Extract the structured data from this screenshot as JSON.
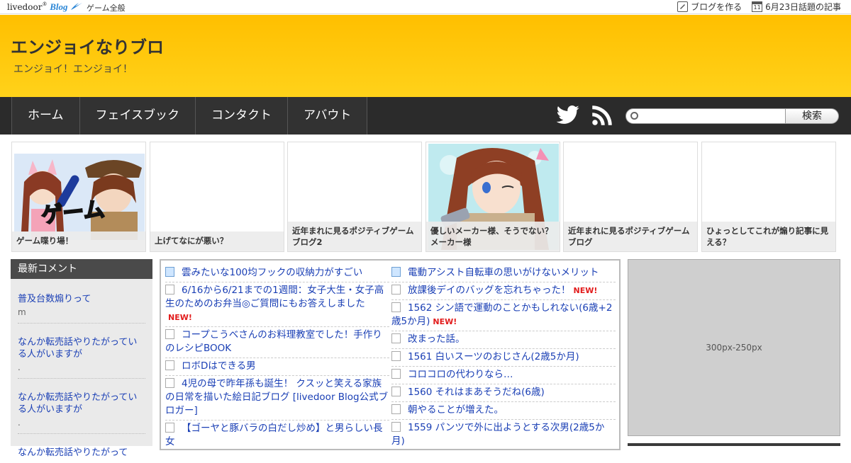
{
  "topbar": {
    "logo_text": "livedoor",
    "logo_blog": "Blog",
    "category": "ゲーム全般",
    "create_blog": "ブログを作る",
    "calendar_day": "11",
    "topic_articles": "6月23日話題の記事"
  },
  "header": {
    "title": "エンジョイなりブロ",
    "subtitle": "エンジョイ！エンジョイ！"
  },
  "nav": {
    "items": [
      "ホーム",
      "フェイスブック",
      "コンタクト",
      "アバウト"
    ],
    "search_button": "検索",
    "search_placeholder": ""
  },
  "thumbnails": [
    {
      "caption": "ゲーム喋り場！",
      "image": "game-chat-characters",
      "art_text": "ゲーム"
    },
    {
      "caption": "上げてなにが悪い？",
      "image": ""
    },
    {
      "caption": "近年まれに見るポジティブゲームブログ2",
      "image": ""
    },
    {
      "caption": "優しいメーカー様、そうでない？メーカー様",
      "image": "winking-girl-character"
    },
    {
      "caption": "近年まれに見るポジティブゲームブログ",
      "image": ""
    },
    {
      "caption": "ひょっとしてこれが煽り記事に見える？",
      "image": ""
    }
  ],
  "sidebar": {
    "heading": "最新コメント",
    "comments": [
      {
        "title": "普及台数煽りって",
        "author": "m"
      },
      {
        "title": "なんか転売話やりたがっている人がいますが",
        "author": "."
      },
      {
        "title": "なんか転売話やりたがっている人がいますが",
        "author": "."
      },
      {
        "title": "なんか転売話やりたがって",
        "author": ""
      }
    ]
  },
  "feed": {
    "new_label": "NEW!",
    "left": [
      {
        "title": "雲みたいな100均フックの収納力がすごい",
        "icon": "pen",
        "new": false
      },
      {
        "title": "6/16から6/21までの1週間：女子大生・女子高生のためのお弁当◎ご質問にもお答えしました",
        "icon": "doc",
        "new": true
      },
      {
        "title": "コープこうべさんのお料理教室でした！手作りのレシピBOOK",
        "icon": "doc",
        "new": false
      },
      {
        "title": "ロボDはできる男",
        "icon": "doc",
        "new": false
      },
      {
        "title": "4児の母で昨年孫も誕生！ クスッと笑える家族の日常を描いた絵日記ブログ [livedoor Blog公式ブロガー]",
        "icon": "doc",
        "new": false
      },
      {
        "title": "【ゴーヤと豚バラの白だし炒め】と男らしい長女",
        "icon": "doc",
        "new": false
      }
    ],
    "right": [
      {
        "title": "電動アシスト自転車の思いがけないメリット",
        "icon": "pen",
        "new": false
      },
      {
        "title": "放課後デイのバッグを忘れちゃった！",
        "icon": "doc",
        "new": true
      },
      {
        "title": "1562 シン語で運動のことかもしれない(6歳+2歳5か月)",
        "icon": "doc",
        "new": true
      },
      {
        "title": "改まった話。",
        "icon": "doc",
        "new": false
      },
      {
        "title": "1561 白いスーツのおじさん(2歳5か月)",
        "icon": "doc",
        "new": false
      },
      {
        "title": "コロコロの代わりなら…",
        "icon": "doc",
        "new": false
      },
      {
        "title": "1560 それはまあそうだね(6歳)",
        "icon": "doc",
        "new": false
      },
      {
        "title": "朝やることが増えた。",
        "icon": "doc",
        "new": false
      },
      {
        "title": "1559 パンツで外に出ようとする次男(2歳5か月)",
        "icon": "doc",
        "new": false
      }
    ]
  },
  "ad": {
    "label": "300px-250px"
  },
  "colors": {
    "header_bg": "#ffc400",
    "nav_bg": "#2b2b2b",
    "link": "#1a3fb5",
    "new_badge": "#e21c1c"
  }
}
